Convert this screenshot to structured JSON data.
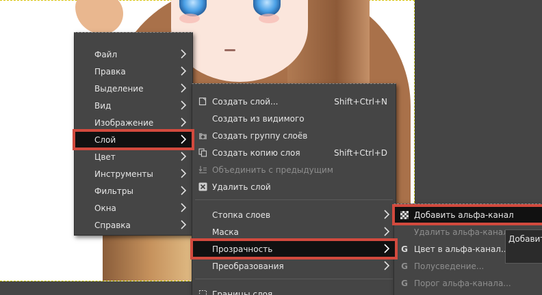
{
  "main_menu": [
    {
      "label": "Файл"
    },
    {
      "label": "Правка"
    },
    {
      "label": "Выделение"
    },
    {
      "label": "Вид"
    },
    {
      "label": "Изображение"
    },
    {
      "label": "Слой"
    },
    {
      "label": "Цвет"
    },
    {
      "label": "Инструменты"
    },
    {
      "label": "Фильтры"
    },
    {
      "label": "Окна"
    },
    {
      "label": "Справка"
    }
  ],
  "layer_menu": {
    "create_layer": {
      "label": "Создать слой...",
      "shortcut": "Shift+Ctrl+N"
    },
    "new_from_visible": {
      "label": "Создать из видимого"
    },
    "new_layer_group": {
      "label": "Создать группу слоёв"
    },
    "duplicate_layer": {
      "label": "Создать копию слоя",
      "shortcut": "Shift+Ctrl+D"
    },
    "merge_down": {
      "label": "Объединить с предыдущим"
    },
    "delete_layer": {
      "label": "Удалить слой"
    },
    "stack": {
      "label": "Стопка слоев"
    },
    "mask": {
      "label": "Маска"
    },
    "transparency": {
      "label": "Прозрачность"
    },
    "transform": {
      "label": "Преобразования"
    },
    "boundary": {
      "label": "Границы слоя"
    }
  },
  "transparency_menu": {
    "add_alpha": {
      "label": "Добавить альфа-канал"
    },
    "remove_alpha": {
      "label": "Удалить альфа-канал"
    },
    "color_to_alpha": {
      "label": "Цвет в альфа-канал..."
    },
    "semi_flatten": {
      "label": "Полусведение..."
    },
    "threshold_alpha": {
      "label": "Порог альфа-канала..."
    }
  },
  "tooltip": {
    "text": "Добавить"
  },
  "colors": {
    "menu_bg": "#454545",
    "highlight_bg": "#111111",
    "highlight_border": "#d24a3e"
  }
}
